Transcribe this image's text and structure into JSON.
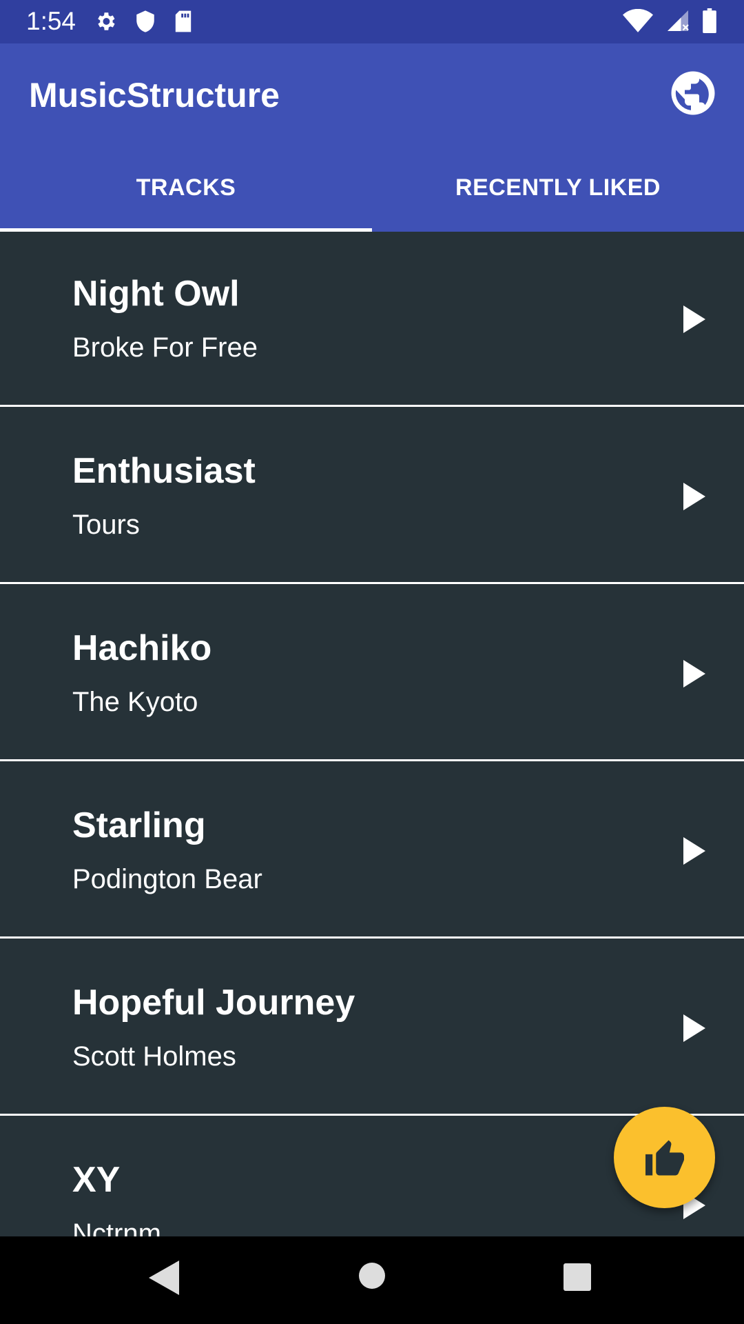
{
  "status_bar": {
    "time": "1:54",
    "left_icons": [
      "gear-icon",
      "shield-icon",
      "sd-card-icon"
    ],
    "right_icons": [
      "wifi-icon",
      "cell-signal-icon",
      "battery-icon"
    ]
  },
  "app_bar": {
    "title": "MusicStructure",
    "action_icon": "globe-icon"
  },
  "tabs": [
    {
      "label": "TRACKS",
      "selected": true
    },
    {
      "label": "RECENTLY LIKED",
      "selected": false
    }
  ],
  "tracks": [
    {
      "title": "Night Owl",
      "artist": "Broke For Free"
    },
    {
      "title": "Enthusiast",
      "artist": "Tours"
    },
    {
      "title": "Hachiko",
      "artist": "The Kyoto"
    },
    {
      "title": "Starling",
      "artist": "Podington Bear"
    },
    {
      "title": "Hopeful Journey",
      "artist": "Scott Holmes"
    },
    {
      "title": "XY",
      "artist": "Nctrnm"
    }
  ],
  "fab": {
    "icon": "thumbs-up-icon",
    "color": "#fbc02d"
  },
  "nav_bar": {
    "icons": [
      "back-icon",
      "home-icon",
      "recents-icon"
    ]
  },
  "colors": {
    "status_bar": "#303f9f",
    "primary": "#3f51b5",
    "list_background": "#263238",
    "accent": "#fbc02d"
  }
}
